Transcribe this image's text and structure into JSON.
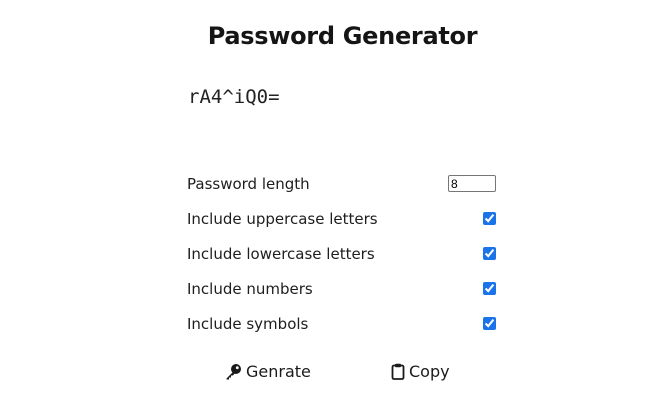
{
  "app": {
    "title": "Password Generator"
  },
  "password": {
    "value": "rA4^iQ0="
  },
  "options": {
    "length": {
      "label": "Password length",
      "value": "8"
    },
    "uppercase": {
      "label": "Include uppercase letters",
      "checked": true
    },
    "lowercase": {
      "label": "Include lowercase letters",
      "checked": true
    },
    "numbers": {
      "label": "Include numbers",
      "checked": true
    },
    "symbols": {
      "label": "Include symbols",
      "checked": true
    }
  },
  "actions": {
    "generate": {
      "label": "Genrate",
      "icon": "key-icon"
    },
    "copy": {
      "label": "Copy",
      "icon": "clipboard-icon"
    }
  },
  "colors": {
    "checkbox_accent": "#1a73e8",
    "text": "#1a1a1a",
    "background": "#ffffff"
  }
}
